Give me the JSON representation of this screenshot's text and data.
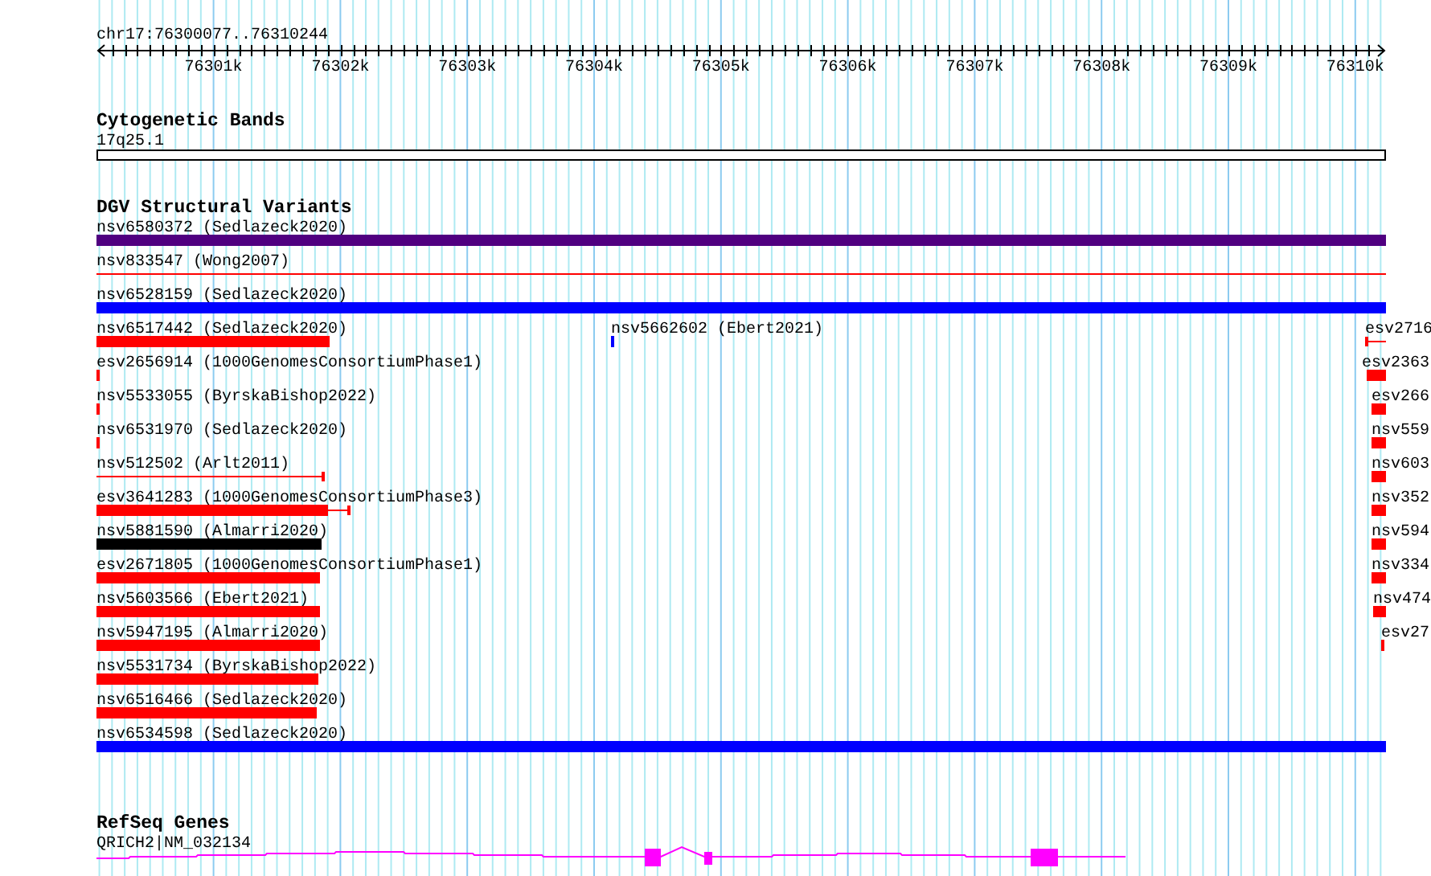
{
  "ruler": {
    "position": "chr17:76300077..76310244",
    "ticks": [
      "76301k",
      "76302k",
      "76303k",
      "76304k",
      "76305k",
      "76306k",
      "76307k",
      "76308k",
      "76309k",
      "76310k"
    ]
  },
  "tracks": [
    {
      "kind": "bands",
      "title": "Cytogenetic Bands",
      "features": [
        {
          "label": "17q25.1"
        }
      ]
    },
    {
      "kind": "variants",
      "title": "DGV Structural Variants",
      "features": [
        {
          "label": "nsv6580372 (Sedlazeck2020)",
          "color": "#500080"
        },
        {
          "label": "nsv833547 (Wong2007)",
          "color": "#ff0000"
        },
        {
          "label": "nsv6528159 (Sedlazeck2020)",
          "color": "#0000ff"
        },
        {
          "label": "nsv6517442 (Sedlazeck2020)",
          "color": "#ff0000"
        },
        {
          "label": "nsv5662602 (Ebert2021)",
          "color": "#0000ff"
        },
        {
          "label": "esv2716",
          "color": "#ff0000"
        },
        {
          "label": "esv2656914 (1000GenomesConsortiumPhase1)",
          "color": "#ff0000"
        },
        {
          "label": "esv2363",
          "color": "#ff0000"
        },
        {
          "label": "nsv5533055 (ByrskaBishop2022)",
          "color": "#ff0000"
        },
        {
          "label": "esv266",
          "color": "#ff0000"
        },
        {
          "label": "nsv6531970 (Sedlazeck2020)",
          "color": "#ff0000"
        },
        {
          "label": "nsv559",
          "color": "#ff0000"
        },
        {
          "label": "nsv512502 (Arlt2011)",
          "color": "#ff0000"
        },
        {
          "label": "nsv603",
          "color": "#ff0000"
        },
        {
          "label": "esv3641283 (1000GenomesConsortiumPhase3)",
          "color": "#ff0000"
        },
        {
          "label": "nsv352",
          "color": "#ff0000"
        },
        {
          "label": "nsv5881590 (Almarri2020)",
          "color": "#000000"
        },
        {
          "label": "nsv594",
          "color": "#ff0000"
        },
        {
          "label": "esv2671805 (1000GenomesConsortiumPhase1)",
          "color": "#ff0000"
        },
        {
          "label": "nsv334",
          "color": "#ff0000"
        },
        {
          "label": "nsv5603566 (Ebert2021)",
          "color": "#ff0000"
        },
        {
          "label": "nsv474",
          "color": "#ff0000"
        },
        {
          "label": "nsv5947195 (Almarri2020)",
          "color": "#ff0000"
        },
        {
          "label": "esv27",
          "color": "#ff0000"
        },
        {
          "label": "nsv5531734 (ByrskaBishop2022)",
          "color": "#ff0000"
        },
        {
          "label": "nsv6516466 (Sedlazeck2020)",
          "color": "#ff0000"
        },
        {
          "label": "nsv6534598 (Sedlazeck2020)",
          "color": "#0000ff"
        }
      ]
    },
    {
      "kind": "genes",
      "title": "RefSeq Genes",
      "features": [
        {
          "label": "QRICH2|NM_032134"
        }
      ]
    }
  ]
}
